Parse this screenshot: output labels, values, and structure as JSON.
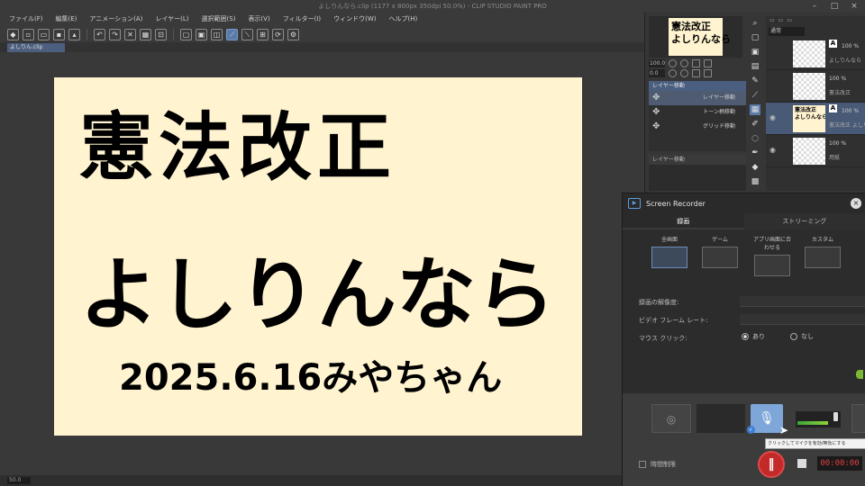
{
  "window": {
    "title": "よしりんなら.clip (1177 x 800px 350dpi 50.0%) - CLIP STUDIO PAINT PRO"
  },
  "menu": [
    "ファイル(F)",
    "編集(E)",
    "アニメーション(A)",
    "レイヤー(L)",
    "選択範囲(S)",
    "表示(V)",
    "フィルター(I)",
    "ウィンドウ(W)",
    "ヘルプ(H)"
  ],
  "document_tab": "よしりん.clip",
  "canvas": {
    "line1": "憲法改正",
    "line2": "よしりんなら",
    "line3": "2025.6.16みやちゃん"
  },
  "statusbar": {
    "zoom": "50.0"
  },
  "navigator": {
    "thumb_line1": "憲法改正",
    "thumb_line2": "よしりんなら",
    "zoom_value": "100.0",
    "angle_value": "0.0"
  },
  "subtool": {
    "header": "レイヤー移動",
    "items": [
      "レイヤー移動",
      "トーン柄移動",
      "グリッド移動"
    ],
    "footer_header": "レイヤー移動"
  },
  "layers": {
    "blend_mode": "通常",
    "rows": [
      {
        "opacity": "100 %",
        "name": "よしりんなら"
      },
      {
        "opacity": "100 %",
        "name": "用紙"
      },
      {
        "opacity": "100 %",
        "name": "憲法改正"
      },
      {
        "opacity": "100 %",
        "name": "憲法改正 よしりんなら"
      },
      {
        "opacity": "100 %",
        "name": "用紙"
      }
    ],
    "thumb_text1": "憲法改正",
    "thumb_text2": "よしりんなら"
  },
  "recorder": {
    "title": "Screen Recorder",
    "tabs": [
      "録画",
      "ストリーミング"
    ],
    "modes": [
      "全画面",
      "ゲーム",
      "アプリ画面に合わせる",
      "カスタム"
    ],
    "settings": {
      "quality_label": "録画の解像度:",
      "framerate_label": "ビデオ フレーム レート:",
      "mouse_label": "マウス クリック:",
      "mouse_on": "あり",
      "mouse_off": "なし"
    },
    "tooltip": "クリックしてマイクを有効/無効にする",
    "time_limit": "時間制限",
    "timer": "00:00:00"
  }
}
